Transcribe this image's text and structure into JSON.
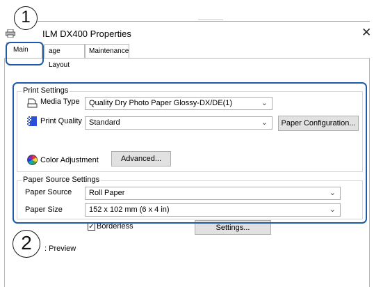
{
  "window": {
    "title": "ILM DX400 Properties",
    "close_glyph": "✕"
  },
  "tabs": [
    {
      "label": "Main"
    },
    {
      "label": "age Layout"
    },
    {
      "label": "Maintenance"
    }
  ],
  "print_settings": {
    "group_label": "Print Settings",
    "media_type_label": "Media Type",
    "media_type_value": "Quality Dry Photo Paper Glossy-DX/DE(1)",
    "print_quality_label": "Print Quality",
    "print_quality_value": "Standard",
    "paper_config_button": "Paper Configuration...",
    "color_adjustment_label": "Color Adjustment",
    "advanced_button": "Advanced..."
  },
  "paper_source_settings": {
    "group_label": "Paper Source Settings",
    "paper_source_label": "Paper Source",
    "paper_source_value": "Roll Paper",
    "paper_size_label": "Paper Size",
    "paper_size_value": "152 x 102 mm (6 x 4 in)"
  },
  "borderless": {
    "label": "Borderless",
    "checked": true,
    "settings_button": "Settings..."
  },
  "preview_label": ": Preview",
  "callouts": {
    "one": "1",
    "two": "2"
  },
  "icons": {
    "app": "printer-icon",
    "media_type": "media-type-icon",
    "print_quality": "print-quality-icon",
    "color_adjustment": "color-wheel-icon",
    "chevron": "chevron-down-icon"
  },
  "colors": {
    "callout": "#1e5aa8",
    "quality_icon": "#2b4fd6"
  }
}
